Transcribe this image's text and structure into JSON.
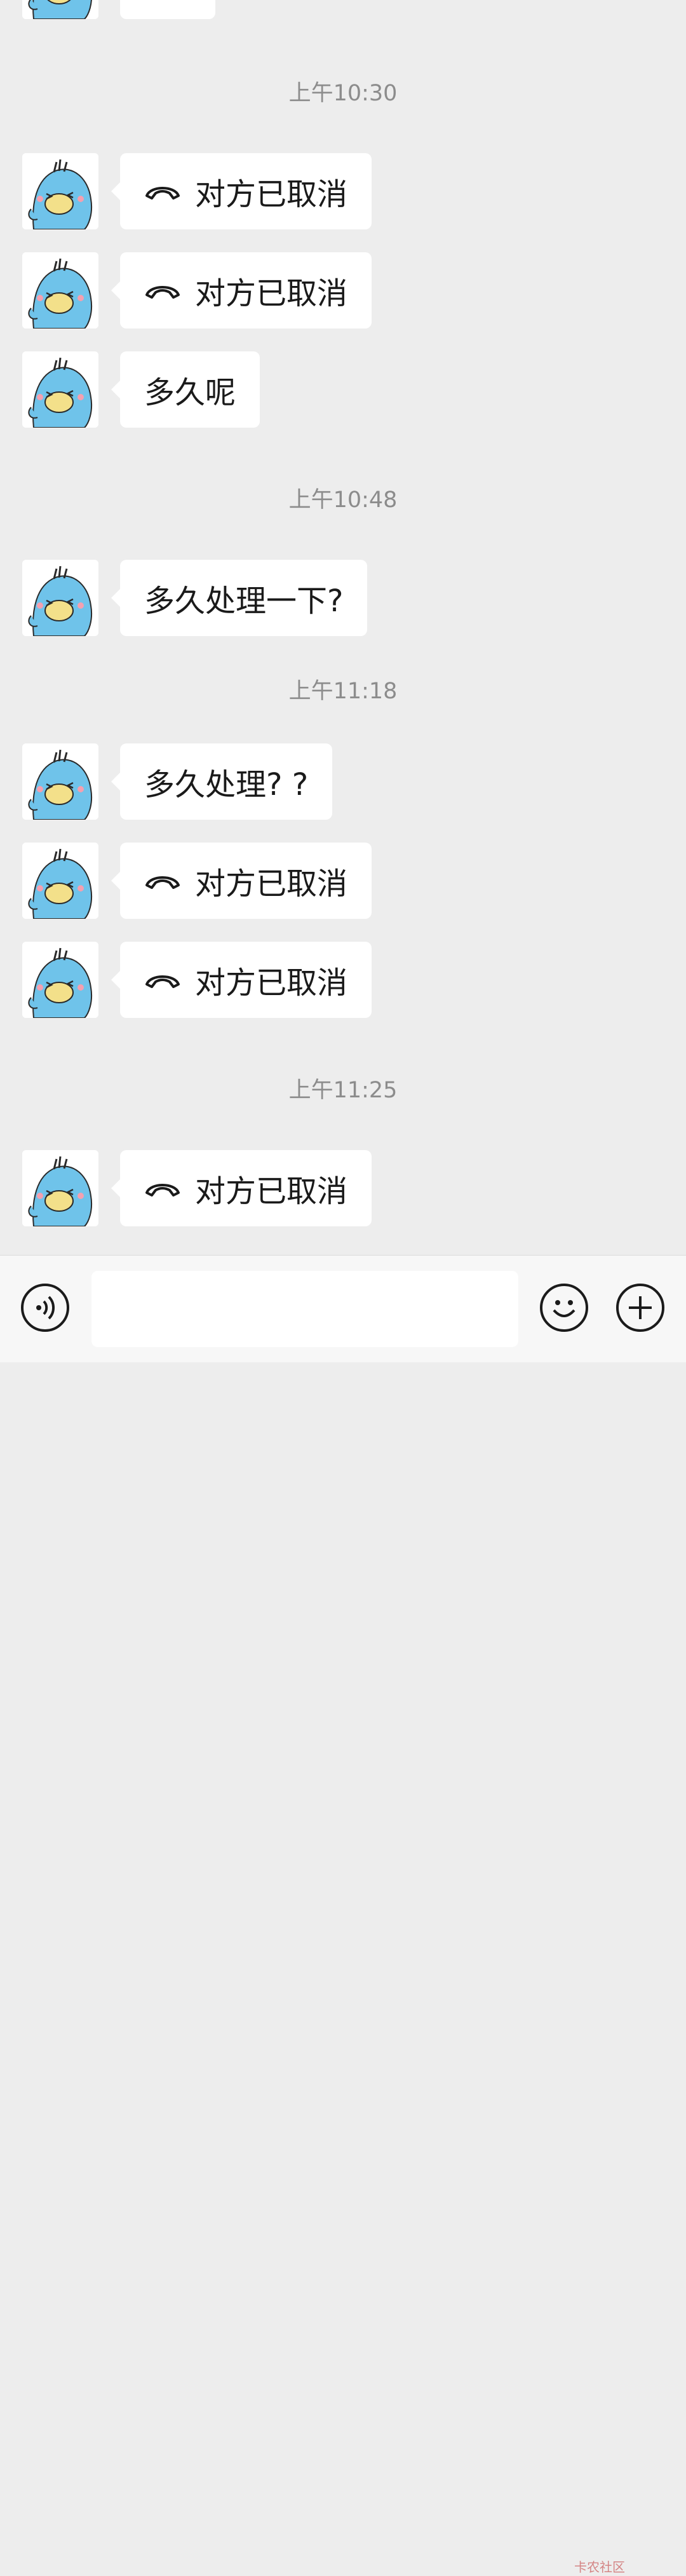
{
  "partial_top_text": "",
  "timestamps": [
    "上午10:30",
    "上午10:48",
    "上午11:18",
    "上午11:25"
  ],
  "messages": [
    {
      "text": "对方已取消",
      "call": true
    },
    {
      "text": "对方已取消",
      "call": true
    },
    {
      "text": "多久呢",
      "call": false
    },
    {
      "text": "多久处理一下?",
      "call": false
    },
    {
      "text": "多久处理? ?",
      "call": false
    },
    {
      "text": "对方已取消",
      "call": true
    },
    {
      "text": "对方已取消",
      "call": true
    },
    {
      "text": "对方已取消",
      "call": true
    }
  ],
  "input": {
    "value": "",
    "placeholder": ""
  },
  "icons": {
    "voice": "voice-icon",
    "emoji": "emoji-icon",
    "add": "plus-icon",
    "call": "phone-hangup-icon"
  },
  "watermark": {
    "text": "卡农社区"
  },
  "colors": {
    "background": "#ededed",
    "bubble": "#ffffff",
    "timestamp": "#8c8c8c",
    "avatar_blue": "#6fc3ea"
  }
}
